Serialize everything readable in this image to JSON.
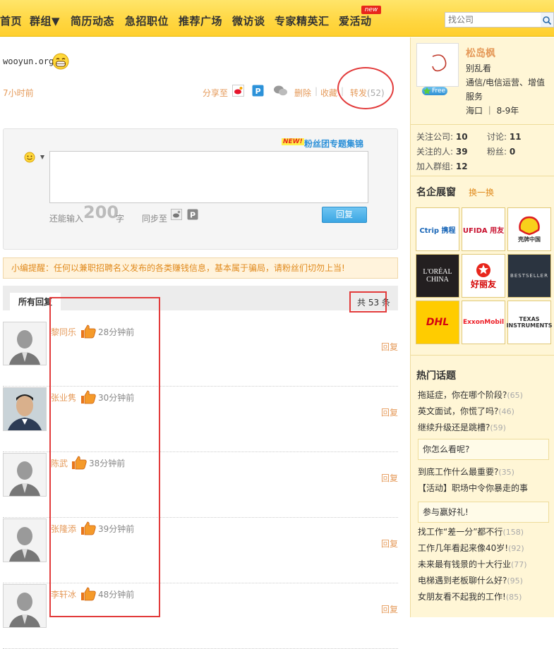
{
  "nav": {
    "items": [
      "首页",
      "群组▼",
      "简历动态",
      "急招职位",
      "推荐广场",
      "微访谈",
      "专家精英汇",
      "爱活动"
    ],
    "new_badge": "new",
    "search_placeholder": "找公司"
  },
  "post": {
    "text": "wooyun.org",
    "time": "7小时前",
    "share_label": "分享至",
    "delete_label": "删除",
    "favorite_label": "收藏",
    "forward_label": "转发",
    "forward_count": "(52)"
  },
  "reply_form": {
    "new_tag": "NEW!",
    "fans_link": "粉丝团专题集锦",
    "can_input_label": "还能输入",
    "char_count": "200",
    "char_unit": "字",
    "sync_label": "同步至",
    "submit_label": "回复"
  },
  "notice": "小编提醒：任何以兼职招聘名义发布的各类赚钱信息，基本属于骗局，请粉丝们切勿上当!",
  "replies": {
    "tab_label": "所有回复",
    "total_label": "共 53 条",
    "reply_link": "回复",
    "items": [
      {
        "name": "黎同乐",
        "time": "28分钟前"
      },
      {
        "name": "张业隽",
        "time": "30分钟前"
      },
      {
        "name": "陈武",
        "time": "38分钟前"
      },
      {
        "name": "张隆添",
        "time": "39分钟前"
      },
      {
        "name": "李轩冰",
        "time": "48分钟前"
      }
    ]
  },
  "profile": {
    "name": "松岛枫",
    "line1": "别乱看",
    "line2": "通信/电信运营、增值",
    "line3": "服务",
    "line4": "海口 ｜ 8-9年",
    "free_badge": "Free"
  },
  "stats": {
    "companies_label": "关注公司:",
    "companies": "10",
    "discuss_label": "讨论:",
    "discuss": "11",
    "people_label": "关注的人:",
    "people": "39",
    "fans_label": "粉丝:",
    "fans": "0",
    "groups_label": "加入群组:",
    "groups": "12"
  },
  "brands": {
    "title": "名企展窗",
    "switch_label": "换一换",
    "items": [
      "Ctrip 携程",
      "UFIDA 用友",
      "壳牌中国",
      "L'ORÉAL CHINA",
      "好丽友",
      "BESTSELLER",
      "DHL",
      "ExxonMobil",
      "TEXAS INSTRUMENTS"
    ]
  },
  "hot_topics": {
    "title": "热门话题",
    "items": [
      {
        "text": "拖延症，你在哪个阶段?",
        "count": "(65)"
      },
      {
        "text": "英文面试，你慌了吗?",
        "count": "(46)"
      },
      {
        "text": "继续升级还是跳槽?",
        "count": "(59)"
      },
      {
        "text": "你怎么看呢?",
        "count": ""
      },
      {
        "text": "到底工作什么最重要?",
        "count": "(35)"
      },
      {
        "text": "【活动】职场中令你暴走的事",
        "count": ""
      },
      {
        "text": "参与赢好礼!",
        "count": ""
      },
      {
        "text": "找工作“差一分”都不行",
        "count": "(158)"
      },
      {
        "text": "工作几年看起来像40岁!",
        "count": "(92)"
      },
      {
        "text": "未来最有钱景的十大行业",
        "count": "(77)"
      },
      {
        "text": "电梯遇到老板聊什么好?",
        "count": "(95)"
      },
      {
        "text": "女朋友看不起我的工作!",
        "count": "(85)"
      }
    ]
  },
  "colors": {
    "accent": "#e59a5a",
    "nav_bg": "#ffd640",
    "annotation_red": "#e23b3b"
  }
}
